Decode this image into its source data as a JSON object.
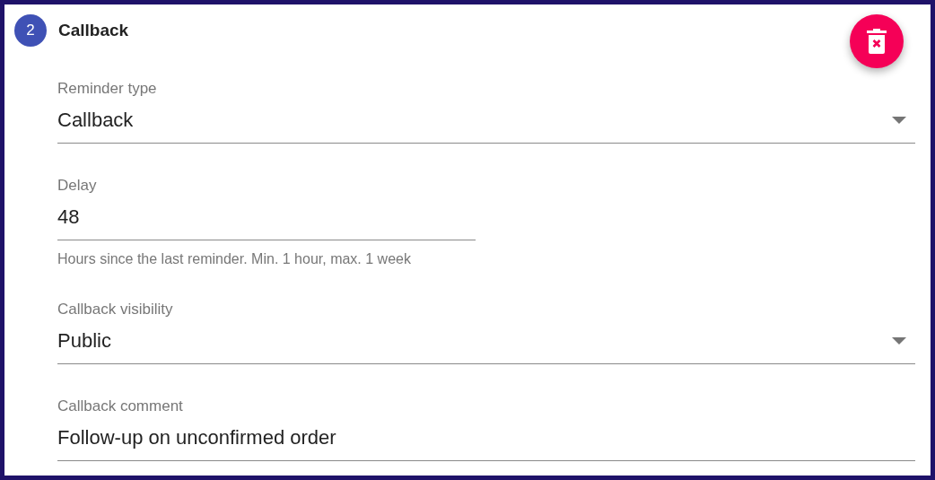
{
  "step": {
    "number": "2",
    "title": "Callback"
  },
  "fields": [
    {
      "kind": "select",
      "label": "Reminder type",
      "value": "Callback",
      "wide": true
    },
    {
      "kind": "input",
      "label": "Delay",
      "value": "48",
      "wide": false,
      "helper": "Hours since the last reminder. Min. 1 hour, max. 1 week"
    },
    {
      "kind": "select",
      "label": "Callback visibility",
      "value": "Public",
      "wide": true
    },
    {
      "kind": "input",
      "label": "Callback comment",
      "value": "Follow-up on unconfirmed order",
      "wide": true
    }
  ]
}
